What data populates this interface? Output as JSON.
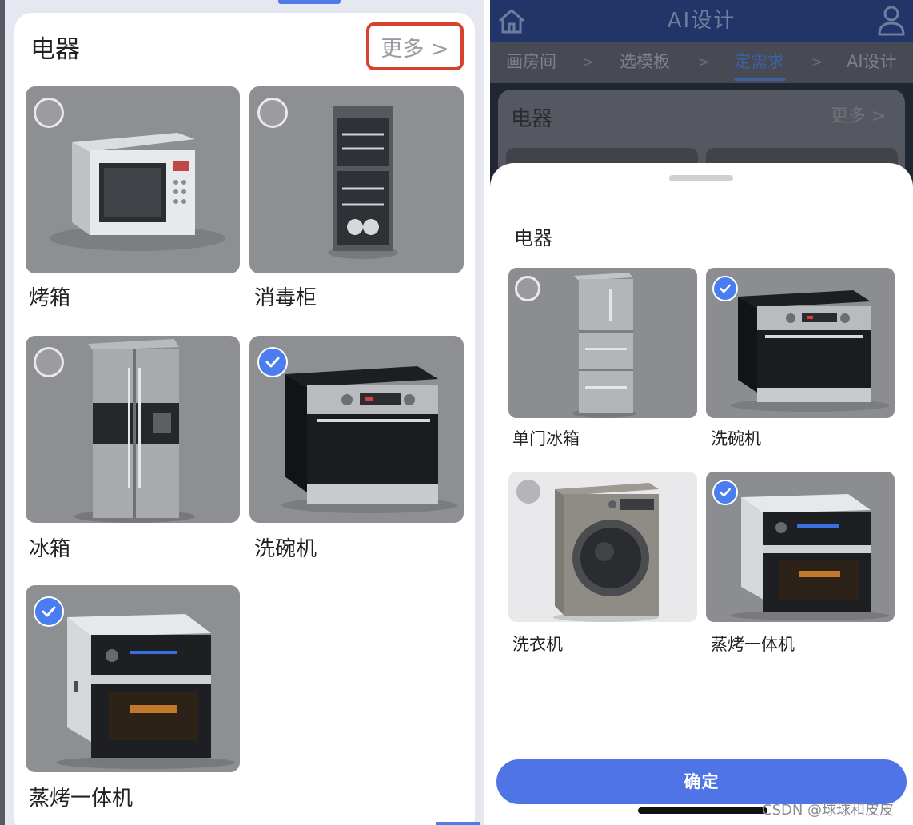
{
  "left": {
    "section_title": "电器",
    "more_label": "更多 >",
    "items": [
      {
        "label": "烤箱",
        "selected": false,
        "icon": "microwave-oven-icon"
      },
      {
        "label": "消毒柜",
        "selected": false,
        "icon": "disinfection-cabinet-icon"
      },
      {
        "label": "冰箱",
        "selected": false,
        "icon": "double-door-fridge-icon"
      },
      {
        "label": "洗碗机",
        "selected": true,
        "icon": "dishwasher-icon"
      },
      {
        "label": "蒸烤一体机",
        "selected": true,
        "icon": "steam-oven-icon"
      }
    ]
  },
  "right": {
    "header": {
      "title": "AI设计",
      "home_icon": "home-icon",
      "user_icon": "user-icon"
    },
    "steps": [
      {
        "label": "画房间",
        "active": false
      },
      {
        "label": "选模板",
        "active": false
      },
      {
        "label": "定需求",
        "active": true
      },
      {
        "label": "AI设计",
        "active": false
      }
    ],
    "step_separator": ">",
    "background_card": {
      "title": "电器",
      "more_label": "更多 >"
    },
    "sheet": {
      "title": "电器",
      "items": [
        {
          "label": "单门冰箱",
          "selected": false,
          "icon": "single-door-fridge-icon"
        },
        {
          "label": "洗碗机",
          "selected": true,
          "icon": "dishwasher-icon"
        },
        {
          "label": "洗衣机",
          "selected": false,
          "icon": "washing-machine-icon"
        },
        {
          "label": "蒸烤一体机",
          "selected": true,
          "icon": "steam-oven-icon"
        }
      ],
      "confirm_label": "确定"
    },
    "watermark": "CSDN @球球和皮皮"
  },
  "colors": {
    "accent": "#4f74e6",
    "highlight_border": "#d9412f",
    "check": "#4a7df0"
  }
}
